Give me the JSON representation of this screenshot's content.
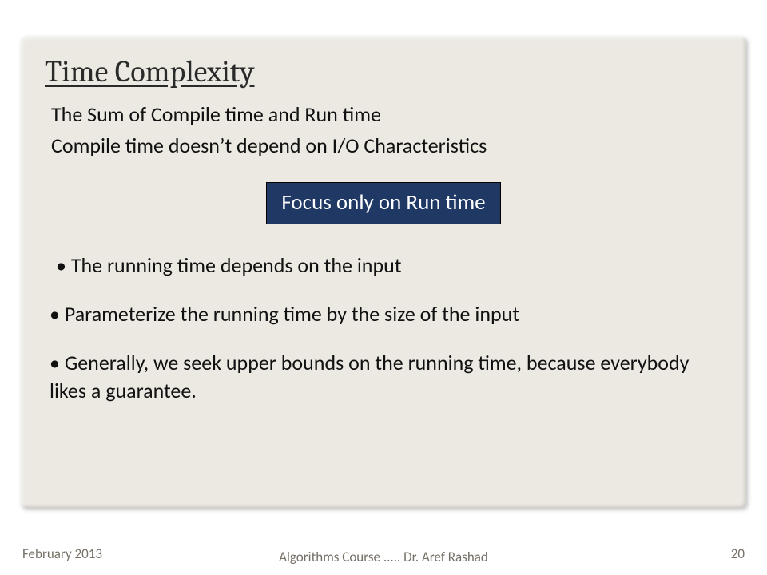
{
  "title": "Time Complexity",
  "lines": {
    "l1": "The Sum of Compile time and Run time",
    "l2": "Compile time doesn’t depend on I/O Characteristics"
  },
  "callout": "Focus only on Run time",
  "bullets": {
    "b1": "The running time depends on the input",
    "b2": " Parameterize the running time by the size of the input",
    "b3": " Generally, we seek upper bounds on the running time, because everybody likes a guarantee."
  },
  "footer": {
    "date": "February 2013",
    "center": "Algorithms Course .....  Dr. Aref Rashad",
    "page": "20"
  }
}
